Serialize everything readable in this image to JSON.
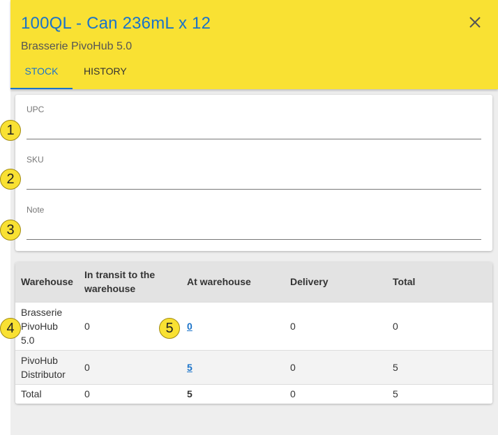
{
  "header": {
    "title": "100QL - Can 236mL x 12",
    "subtitle": "Brasserie PivoHub 5.0",
    "tabs": [
      {
        "label": "STOCK",
        "active": true
      },
      {
        "label": "HISTORY",
        "active": false
      }
    ],
    "close_icon": "close-icon"
  },
  "form": {
    "fields": [
      {
        "label": "UPC",
        "value": ""
      },
      {
        "label": "SKU",
        "value": ""
      },
      {
        "label": "Note",
        "value": ""
      }
    ]
  },
  "table": {
    "columns": [
      "Warehouse",
      "In transit to the warehouse",
      "At warehouse",
      "Delivery",
      "Total"
    ],
    "rows": [
      [
        "Brasserie PivoHub 5.0",
        "0",
        "0",
        "0",
        "0"
      ],
      [
        "PivoHub Distributor",
        "0",
        "5",
        "0",
        "5"
      ],
      [
        "Total",
        "0",
        "5",
        "0",
        "5"
      ]
    ]
  },
  "badges": [
    "1",
    "2",
    "3",
    "4",
    "5"
  ],
  "colors": {
    "header_bg": "#f9e133",
    "accent": "#1a73c9"
  }
}
